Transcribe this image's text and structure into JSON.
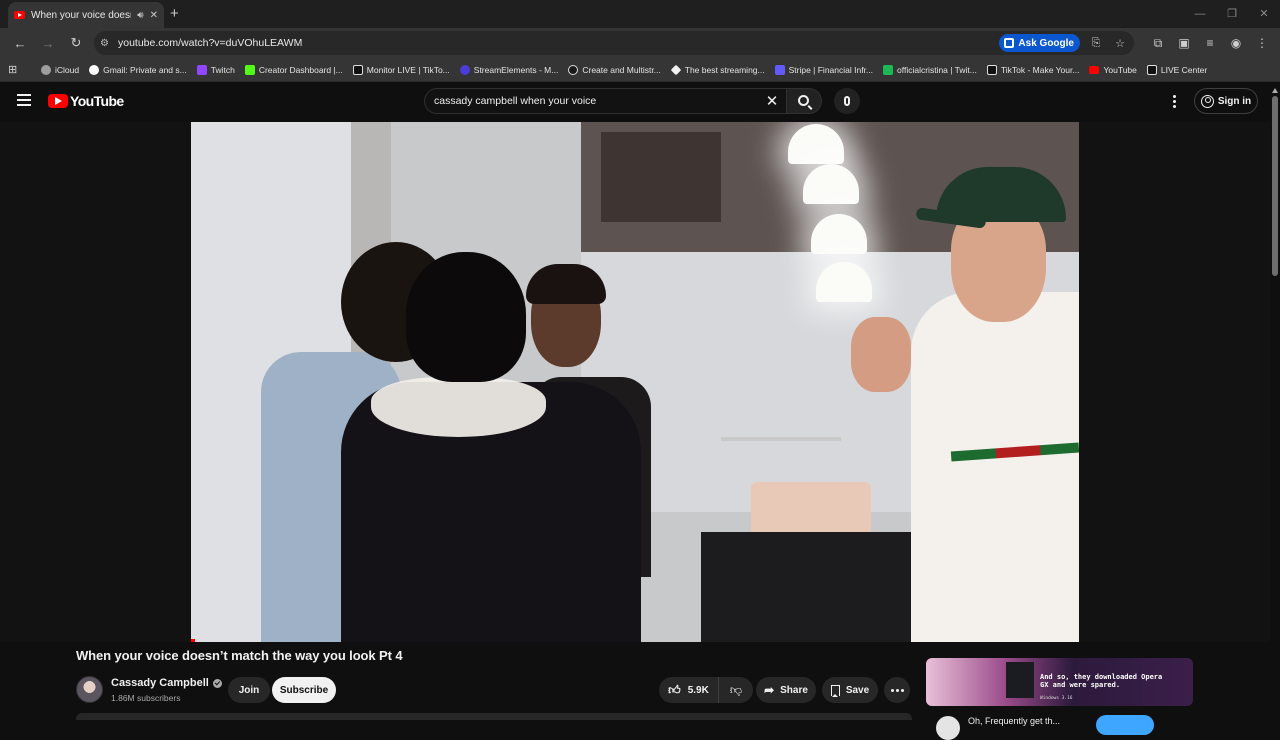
{
  "browser": {
    "tab_title": "When your voice doesn't m",
    "url": "youtube.com/watch?v=duVOhuLEAWM",
    "ask_google_label": "Ask Google",
    "bookmarks": [
      {
        "label": "iCloud",
        "icon": "apple-icon",
        "color": "#9e9e9e"
      },
      {
        "label": "Gmail: Private and s...",
        "icon": "google-icon",
        "color": "#ffffff"
      },
      {
        "label": "Twitch",
        "icon": "twitch-icon",
        "color": "#9146ff"
      },
      {
        "label": "Creator Dashboard |...",
        "icon": "kick-icon",
        "color": "#53fc18"
      },
      {
        "label": "Monitor LIVE | TikTo...",
        "icon": "tiktok-icon",
        "color": "#111111"
      },
      {
        "label": "StreamElements - M...",
        "icon": "streamelements-icon",
        "color": "#4b3cd6"
      },
      {
        "label": "Create and Multistr...",
        "icon": "restream-icon",
        "color": "#1a1a1a"
      },
      {
        "label": "The best streaming...",
        "icon": "diamond-icon",
        "color": "#f1f1f1"
      },
      {
        "label": "Stripe | Financial Infr...",
        "icon": "stripe-icon",
        "color": "#635bff"
      },
      {
        "label": "officialcristina | Twit...",
        "icon": "twitch-green-icon",
        "color": "#1db954"
      },
      {
        "label": "TikTok - Make Your...",
        "icon": "tiktok-icon",
        "color": "#111111"
      },
      {
        "label": "YouTube",
        "icon": "youtube-icon",
        "color": "#ff0000"
      },
      {
        "label": "LIVE Center",
        "icon": "tiktok-icon",
        "color": "#111111"
      }
    ]
  },
  "masthead": {
    "logo_text": "YouTube",
    "search_query": "cassady campbell when your voice",
    "sign_in_label": "Sign in"
  },
  "video": {
    "title": "When your voice doesn’t match the way you look Pt 4"
  },
  "owner": {
    "channel_name": "Cassady Campbell",
    "subscribers": "1.86M subscribers",
    "join_label": "Join",
    "subscribe_label": "Subscribe"
  },
  "actions": {
    "like_count": "5.9K",
    "share_label": "Share",
    "save_label": "Save"
  },
  "ad": {
    "headline": "And so, they downloaded Opera GX and were spared.",
    "subline": "Windows 3.16"
  },
  "next_item": {
    "name": "Oh, Frequently get th..."
  },
  "colors": {
    "accent_red": "#ff0000",
    "page_bg": "#0f0f0f",
    "ask_google_blue": "#0b57d0"
  }
}
